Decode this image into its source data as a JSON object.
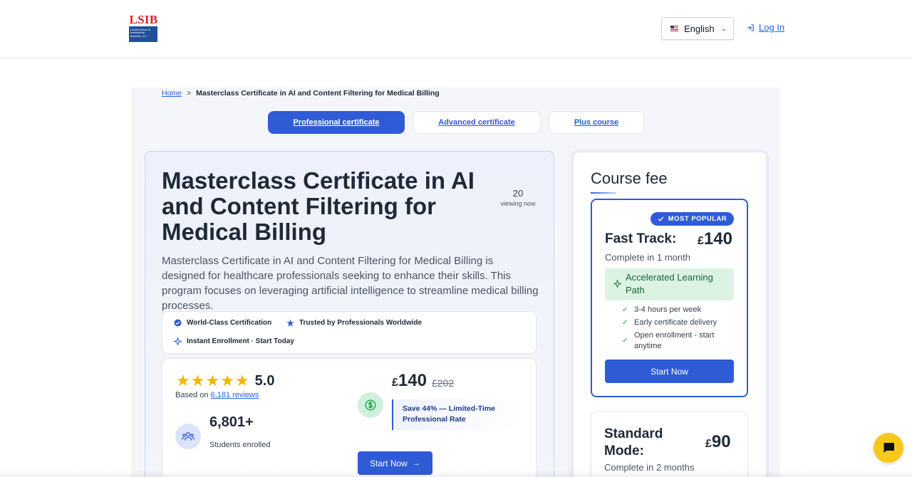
{
  "header": {
    "logo": {
      "text": "LSIB",
      "subtext": "London School of International Business, U.K."
    },
    "language": {
      "flag_icon": "us-flag-icon",
      "label": "English",
      "chevron_icon": "chevron-down-icon"
    },
    "login": {
      "label": "Log In",
      "icon": "login-icon"
    }
  },
  "breadcrumb": {
    "home": "Home",
    "separator": ">",
    "current": "Masterclass Certificate in AI and Content Filtering for Medical Billing"
  },
  "tabs": [
    {
      "label": "Professional certificate",
      "active": true
    },
    {
      "label": "Advanced certificate",
      "active": false
    },
    {
      "label": "Plus course",
      "active": false
    }
  ],
  "course": {
    "title": "Masterclass Certificate in AI and Content Filtering for Medical Billing",
    "viewing_count": "20",
    "viewing_label": "viewing now",
    "description": "Masterclass Certificate in AI and Content Filtering for Medical Billing is designed for healthcare professionals seeking to enhance their skills. This program focuses on leveraging artificial intelligence to streamline medical billing processes."
  },
  "features": [
    {
      "icon": "badge-check-icon",
      "label": "World-Class Certification"
    },
    {
      "icon": "star-icon",
      "label": "Trusted by Professionals Worldwide"
    },
    {
      "icon": "lightning-icon",
      "label": "Instant Enrollment · Start Today"
    }
  ],
  "stats": {
    "rating": "5.0",
    "stars": 5,
    "based_on_prefix": "Based on",
    "reviews_link": "6,181 reviews",
    "students_count": "6,801+",
    "students_label": "Students enrolled",
    "price_currency": "£",
    "price": "140",
    "old_price": "£202",
    "save_text_line1": "Save 44% — Limited-Time",
    "save_text_line2": "Professional Rate",
    "start_label": "Start Now",
    "start_arrow": "→"
  },
  "course_fee": {
    "title": "Course fee",
    "fast_track": {
      "badge": "MOST POPULAR",
      "name": "Fast Track:",
      "currency": "£",
      "price": "140",
      "duration": "Complete in 1 month",
      "highlight": "Accelerated Learning Path",
      "bullets": [
        "3-4 hours per week",
        "Early certificate delivery",
        "Open enrollment - start anytime"
      ],
      "start_label": "Start Now"
    },
    "standard": {
      "name_line1": "Standard",
      "name_line2": "Mode:",
      "currency": "£",
      "price": "90",
      "duration": "Complete in 2 months"
    }
  },
  "colors": {
    "accent": "#2f5bd7",
    "star": "#f5b400",
    "chat": "#f8c91c",
    "success": "#16a34a"
  }
}
